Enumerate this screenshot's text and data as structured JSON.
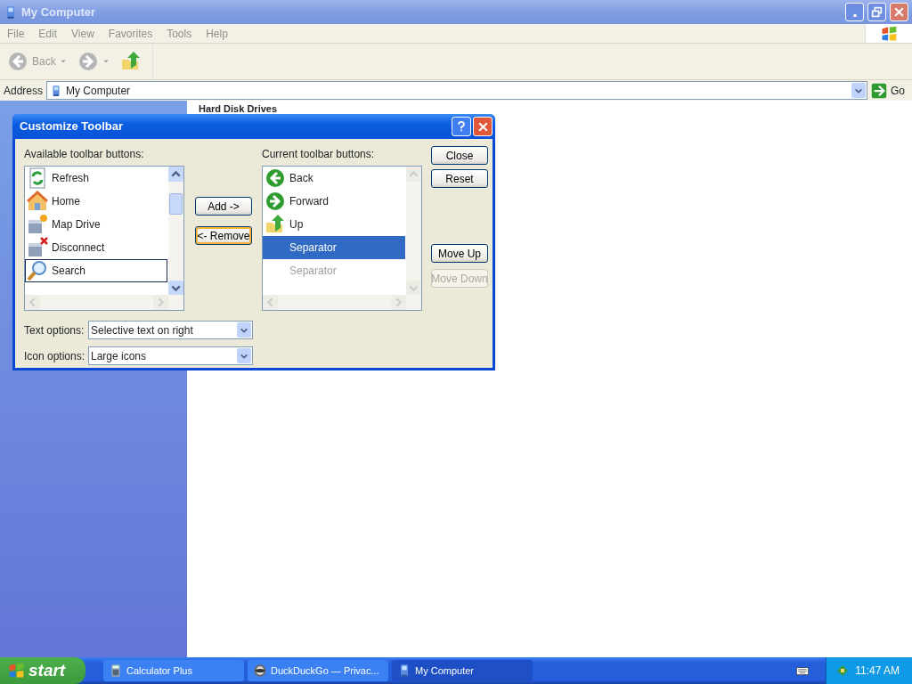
{
  "window": {
    "title": "My Computer"
  },
  "menu": [
    "File",
    "Edit",
    "View",
    "Favorites",
    "Tools",
    "Help"
  ],
  "toolbar": {
    "back": {
      "label": "Back",
      "disabled": true
    },
    "forward": {
      "disabled": true
    }
  },
  "address": {
    "label": "Address",
    "value": "My Computer",
    "go": "Go"
  },
  "content": {
    "heading": "Hard Disk Drives"
  },
  "dialog": {
    "title": "Customize Toolbar",
    "available_label": "Available toolbar buttons:",
    "available": [
      {
        "label": "Refresh",
        "focused": false
      },
      {
        "label": "Home",
        "focused": false
      },
      {
        "label": "Map Drive",
        "focused": false
      },
      {
        "label": "Disconnect",
        "focused": false
      },
      {
        "label": "Search",
        "focused": true
      }
    ],
    "current_label": "Current toolbar buttons:",
    "current": [
      {
        "label": "Back",
        "selected": false,
        "dimmed": false
      },
      {
        "label": "Forward",
        "selected": false,
        "dimmed": false
      },
      {
        "label": "Up",
        "selected": false,
        "dimmed": false
      },
      {
        "label": "Separator",
        "selected": true,
        "dimmed": false
      },
      {
        "label": "Separator",
        "selected": false,
        "dimmed": true
      }
    ],
    "buttons": [
      {
        "kind": "add",
        "label": "Add ->",
        "default": false,
        "disabled": false
      },
      {
        "kind": "remove",
        "label": "<- Remove",
        "default": true,
        "disabled": false
      },
      {
        "kind": "close",
        "label": "Close",
        "default": false,
        "disabled": false
      },
      {
        "kind": "reset",
        "label": "Reset",
        "default": false,
        "disabled": false
      },
      {
        "kind": "moveup",
        "label": "Move Up",
        "default": false,
        "disabled": false
      },
      {
        "kind": "movedown",
        "label": "Move Down",
        "default": false,
        "disabled": true
      }
    ],
    "options": [
      {
        "label": "Text options:",
        "value": "Selective text on right"
      },
      {
        "label": "Icon options:",
        "value": "Large icons"
      }
    ]
  },
  "taskbar": {
    "start": "start",
    "tasks": [
      {
        "label": "Calculator Plus",
        "selected": false
      },
      {
        "label": "DuckDuckGo — Privac...",
        "selected": false
      },
      {
        "label": "My Computer",
        "selected": true
      }
    ],
    "clock": "11:47 AM"
  }
}
